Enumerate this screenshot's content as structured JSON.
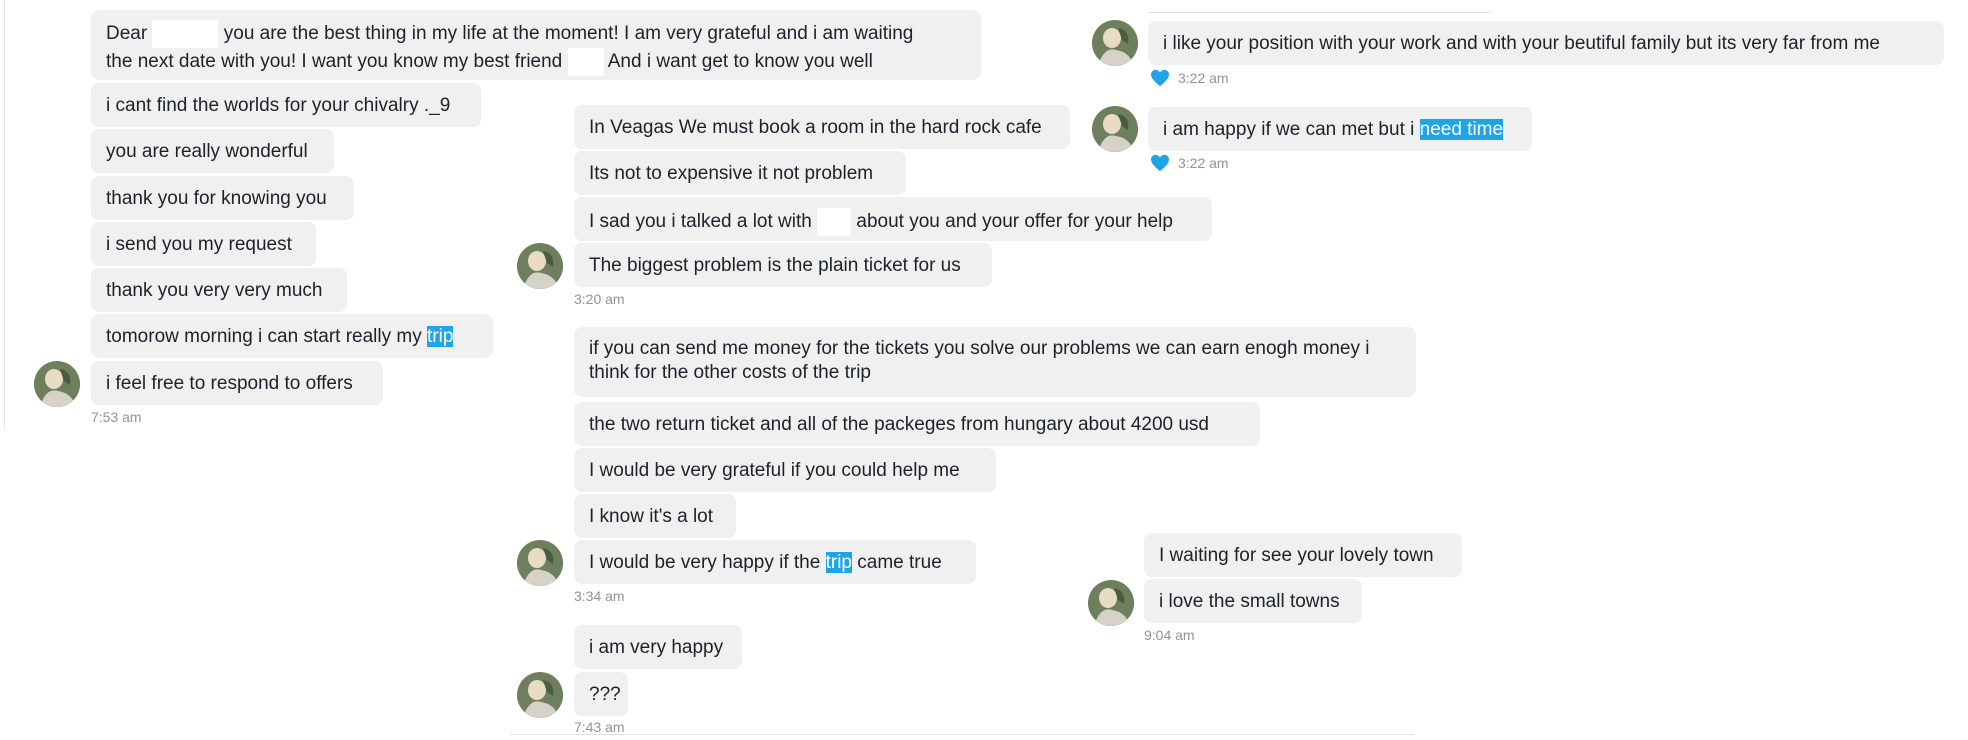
{
  "col1": {
    "msg1_a": "Dear ",
    "msg1_b": " you are the best thing in my life at the moment! I am very grateful and i am waiting",
    "msg1_c": "the next date with you! I want you know my best friend ",
    "msg1_d": " And i want get to know you well",
    "msg2": "i cant find the worlds for your chivalry ._9",
    "msg3": "you are really wonderful",
    "msg4": "thank you for knowing you",
    "msg5": "i send you my request",
    "msg6": "thank you very very much",
    "msg7_a": "tomorow morning i can start really my ",
    "msg7_hl": "trip",
    "msg8": "i feel free to respond to offers",
    "time": "7:53 am"
  },
  "col2a": {
    "msg1": "In Veagas We must book a room in the hard rock cafe",
    "msg2": "Its not to expensive it not problem",
    "msg3_a": "I sad you i talked a lot with ",
    "msg3_b": " about you and your offer for your help",
    "msg4": "The biggest problem is the plain ticket for us",
    "time": "3:20 am"
  },
  "col2b": {
    "msg1": "if you can send me money for the tickets you solve our problems we can earn enogh money i think for the other costs of the trip",
    "msg2": "the two return ticket and all of the packeges from hungary about 4200 usd",
    "msg3": "I would be very grateful if you could help me",
    "msg4": "I know it's a lot",
    "msg5_a": "I would be very happy if the ",
    "msg5_hl": "trip",
    "msg5_b": " came true",
    "time": "3:34 am"
  },
  "col2c": {
    "msg1": "i am very happy",
    "msg2": "???",
    "time": "7:43 am"
  },
  "col3": {
    "msg1": "i like your position with your work and with your beutiful family but its very far from me",
    "msg1_time": "3:22 am",
    "msg2_a": "i am happy if we can met but i ",
    "msg2_hl": "need time",
    "msg2_time": "3:22 am",
    "msg3": "I waiting for see your lovely town",
    "msg4": "i love the small towns",
    "time": "9:04 am"
  },
  "colors": {
    "bubble": "#f1f0f0",
    "highlight": "#20a4e8",
    "heart": "#20a4e8",
    "timestamp": "#8d949e"
  },
  "icons": [
    "avatar",
    "heart-reaction-icon"
  ]
}
